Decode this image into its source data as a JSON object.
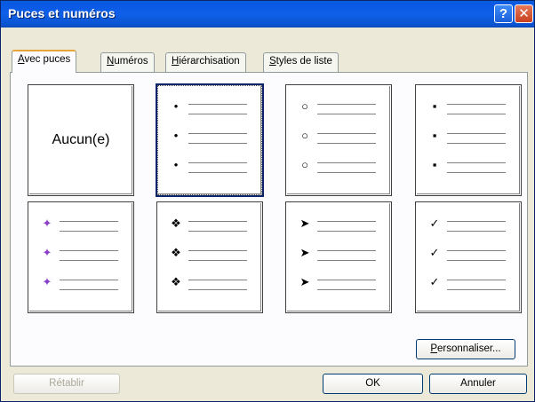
{
  "window": {
    "title": "Puces et numéros",
    "help_glyph": "?",
    "close_glyph": "✕"
  },
  "tabs": [
    {
      "mnem": "A",
      "rest": "vec puces",
      "active": true
    },
    {
      "mnem": "N",
      "rest": "uméros",
      "active": false
    },
    {
      "mnem": "H",
      "rest": "iérarchisation",
      "active": false
    },
    {
      "mnem": "S",
      "rest": "tyles de liste",
      "active": false
    }
  ],
  "gallery": {
    "none_label": "Aucun(e)",
    "bullet_sets": [
      {
        "icon": "none-option",
        "glyph": ""
      },
      {
        "icon": "dot-bullet-icon",
        "glyph": "•"
      },
      {
        "icon": "circle-bullet-icon",
        "glyph": "○"
      },
      {
        "icon": "square-bullet-icon",
        "glyph": "▪"
      },
      {
        "icon": "picture-bullet-icon",
        "glyph": "✦"
      },
      {
        "icon": "diamond-cross-bullet-icon",
        "glyph": "❖"
      },
      {
        "icon": "arrowhead-bullet-icon",
        "glyph": "➤"
      },
      {
        "icon": "checkmark-bullet-icon",
        "glyph": "✓"
      }
    ],
    "selected_index": 1
  },
  "buttons": {
    "customize": {
      "mnem": "P",
      "rest": "ersonnaliser..."
    },
    "reset": "Rétablir",
    "ok": "OK",
    "cancel": "Annuler"
  }
}
